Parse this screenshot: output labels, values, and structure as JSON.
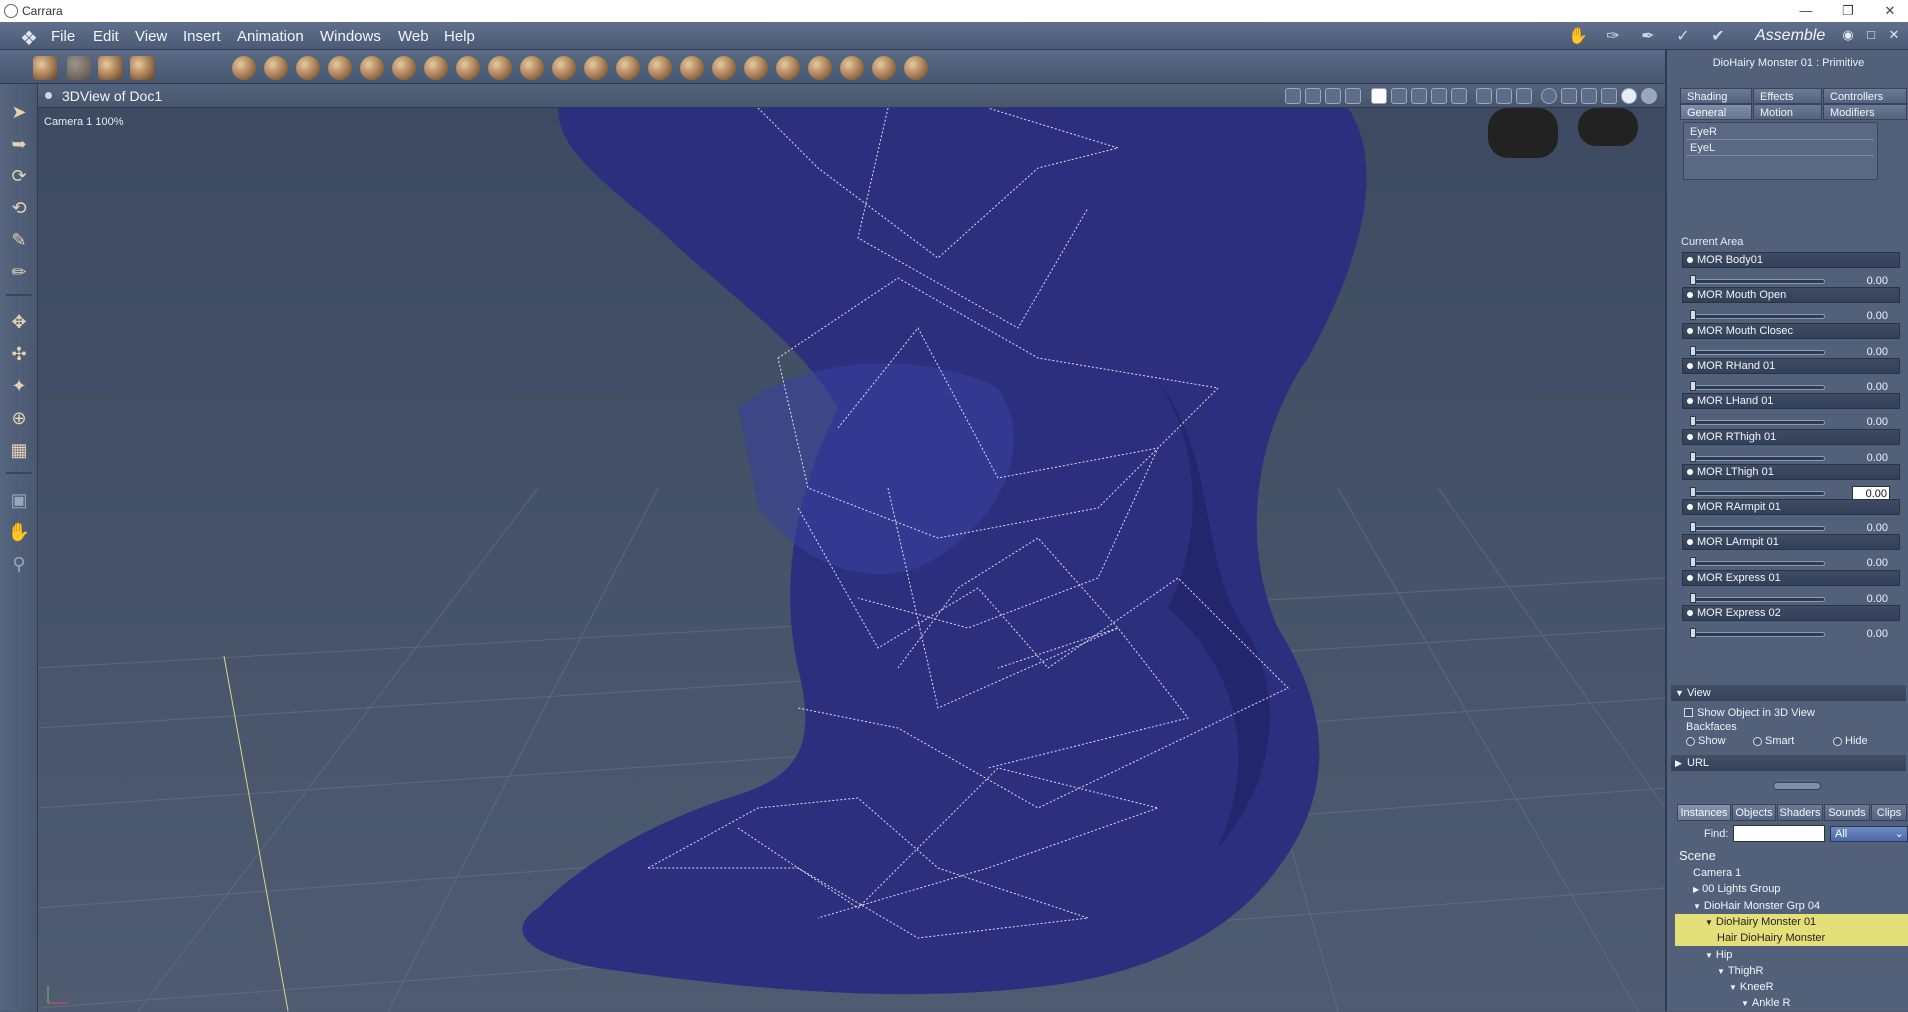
{
  "app": {
    "title": "Carrara"
  },
  "menu": [
    "File",
    "Edit",
    "View",
    "Insert",
    "Animation",
    "Windows",
    "Web",
    "Help"
  ],
  "room": {
    "label": "Assemble"
  },
  "viewport": {
    "title": "3DView of Doc1",
    "camera_label": "Camera 1 100%"
  },
  "properties": {
    "title": "DioHairy Monster 01 : Primitive",
    "tabs_top": [
      "Shading",
      "Effects",
      "Controllers"
    ],
    "tabs_bottom": [
      "General",
      "Motion",
      "Modifiers"
    ],
    "list_items": [
      "EyeR",
      "EyeL"
    ],
    "current_area_label": "Current Area",
    "morphs": [
      {
        "name": "MOR Body01",
        "value": "0.00"
      },
      {
        "name": "MOR Mouth Open",
        "value": "0.00"
      },
      {
        "name": "MOR Mouth Closec",
        "value": "0.00"
      },
      {
        "name": "MOR RHand 01",
        "value": "0.00"
      },
      {
        "name": "MOR LHand 01",
        "value": "0.00"
      },
      {
        "name": "MOR RThigh 01",
        "value": "0.00"
      },
      {
        "name": "MOR LThigh 01",
        "value": "0.00"
      },
      {
        "name": "MOR RArmpit 01",
        "value": "0.00"
      },
      {
        "name": "MOR LArmpit 01",
        "value": "0.00"
      },
      {
        "name": "MOR Express 01",
        "value": "0.00"
      },
      {
        "name": "MOR Express 02",
        "value": "0.00"
      }
    ],
    "view_section": {
      "title": "View",
      "show_object_label": "Show Object in 3D View",
      "backfaces_label": "Backfaces",
      "options": [
        "Show",
        "Smart",
        "Hide"
      ]
    },
    "url_section": {
      "title": "URL"
    }
  },
  "browser": {
    "tabs": [
      "Instances",
      "Objects",
      "Shaders",
      "Sounds",
      "Clips"
    ],
    "find_label": "Find:",
    "find_value": "",
    "filter_value": "All",
    "scene_label": "Scene",
    "tree": [
      {
        "label": "Camera 1"
      },
      {
        "label": "00 Lights Group"
      },
      {
        "label": "DioHair Monster Grp 04"
      },
      {
        "label": "DioHairy Monster 01"
      },
      {
        "label": "Hair DioHairy Monster"
      },
      {
        "label": "Hip"
      },
      {
        "label": "ThighR"
      },
      {
        "label": "KneeR"
      },
      {
        "label": "Ankle R"
      }
    ]
  },
  "colors": {
    "accent": "#e5df7a",
    "figure": "#2b2f7e",
    "panel": "#52607a"
  }
}
